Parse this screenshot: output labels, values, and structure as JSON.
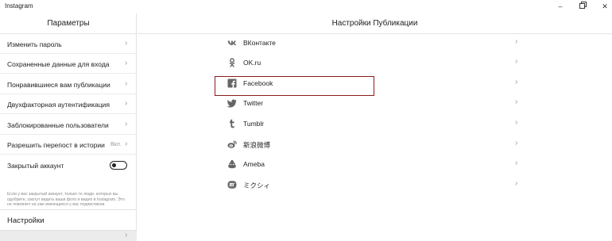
{
  "window": {
    "title": "Instagram",
    "minimize": "–",
    "close": "✕"
  },
  "sidebar": {
    "title": "Параметры",
    "items": [
      {
        "label": "Изменить пароль",
        "chevron": "›"
      },
      {
        "label": "Сохраненные данные для входа",
        "chevron": "›"
      },
      {
        "label": "Понравившиеся вам публикации",
        "chevron": "›"
      },
      {
        "label": "Двухфакторная аутентификация",
        "chevron": "›"
      },
      {
        "label": "Заблокированные пользователи",
        "chevron": "›"
      },
      {
        "label": "Разрешить перепост в истории",
        "value": "Вкл.",
        "chevron": "›"
      }
    ],
    "private_account": {
      "label": "Закрытый аккаунт",
      "enabled": false,
      "note": "Если у вас закрытый аккаунт, только те люди, которых вы одобрите, смогут видеть ваши фото и видео в Instagram. Это не повлияет на уже имеющихся у вас подписчиков."
    },
    "section_label": "Настройки",
    "selected_chevron": "›"
  },
  "main": {
    "title": "Настройки Публикации",
    "accounts": [
      {
        "label": "ВКонтакте",
        "icon": "vk-icon",
        "chevron": "›"
      },
      {
        "label": "OK.ru",
        "icon": "odnoklassniki-icon",
        "chevron": "›"
      },
      {
        "label": "Facebook",
        "icon": "facebook-icon",
        "chevron": "›"
      },
      {
        "label": "Twitter",
        "icon": "twitter-icon",
        "chevron": "›"
      },
      {
        "label": "Tumblr",
        "icon": "tumblr-icon",
        "chevron": "›"
      },
      {
        "label": "新浪微博",
        "icon": "weibo-icon",
        "chevron": "›"
      },
      {
        "label": "Ameba",
        "icon": "ameba-icon",
        "chevron": "›"
      },
      {
        "label": "ミクシィ",
        "icon": "mixi-icon",
        "chevron": "›"
      }
    ]
  },
  "colors": {
    "highlight_border": "#8b1c1c",
    "divider": "#e3e3e3",
    "chevron": "#9a9a9a",
    "icon": "#666666"
  }
}
